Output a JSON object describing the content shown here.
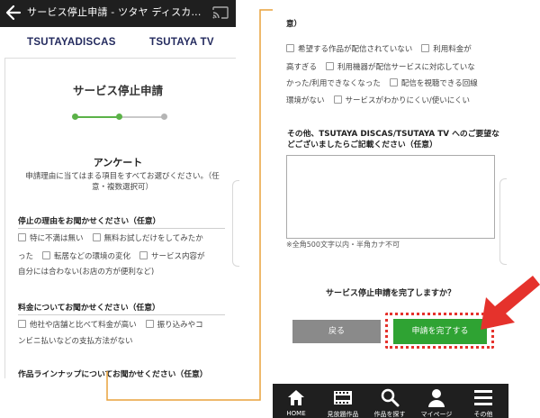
{
  "left": {
    "app_bar": {
      "title": "サービス停止申請 - ツタヤ ディスカ..."
    },
    "brands": {
      "discas": "TSUTAYADISCAS",
      "tv": "TSUTAYA TV"
    },
    "page_title": "サービス停止申請",
    "stepper": {
      "total_steps": 3,
      "current_step": 2
    },
    "survey": {
      "title": "アンケート",
      "description_lines": [
        "申請理由に当てはまる項目をすべてお選びください。（任",
        "意・複数選択可）"
      ]
    },
    "q1": {
      "label": "停止の理由をお聞かせください（任意）",
      "opt1": "特に不満は無い",
      "opt2": "無料お試しだけをしてみたか",
      "opt2b": "った",
      "opt3": "転居などの環境の変化",
      "opt4": "サービス内容が",
      "opt4b": "自分には合わない(お店の方が便利など)"
    },
    "q2": {
      "label": "料金についてお聞かせください（任意）",
      "opt1": "他社や店舗と比べて料金が高い",
      "opt2": "振り込みやコ",
      "opt2b": "ンビニ払いなどの支払方法がない"
    },
    "q3": {
      "label": "作品ラインナップについてお聞かせください（任意）"
    }
  },
  "right": {
    "top_clipped": "意）",
    "opts": {
      "a": "希望する作品が配信されていない",
      "b": "利用料金が",
      "c": "高すぎる",
      "d": "利用機器が配信サービスに対応していな",
      "e": "かった/利用できなくなった",
      "f": "配信を視聴できる回線",
      "g": "環境がない",
      "h": "サービスがわかりにくい/使いにくい"
    },
    "other_label": "その他、TSUTAYA DISCAS/TSUTAYA TV へのご要望などございましたらご記載ください（任意）",
    "char_note": "※全角500文字以内・半角カナ不可",
    "confirm_question": "サービス停止申請を完了しますか？",
    "back_button": "戻る",
    "complete_button": "申請を完了する",
    "nav": {
      "home": "HOME",
      "owned": "見放題作品",
      "search": "作品を探す",
      "mypage": "マイページ",
      "other": "その他"
    }
  },
  "colors": {
    "step_active": "#5bb248",
    "step_inactive": "#b5b5b5",
    "brand": "#232a5e",
    "connector": "#e9a23b",
    "complete_button": "#2fa333",
    "highlight": "#e5322c",
    "nav_bg": "#1f1f1f"
  },
  "icons": {
    "back": "back-arrow-icon",
    "cast": "cast-icon",
    "home": "home-icon",
    "owned": "film-icon",
    "search": "search-icon",
    "mypage": "person-icon",
    "other": "menu-icon",
    "pointer": "red-arrow-icon"
  }
}
